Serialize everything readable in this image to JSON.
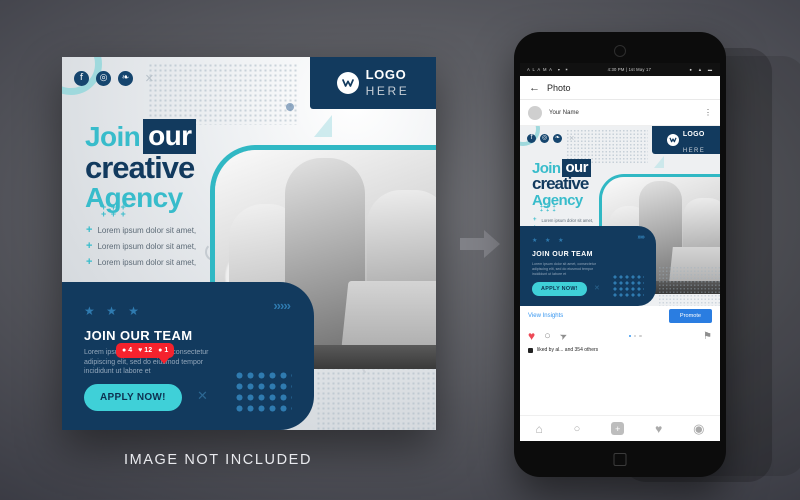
{
  "caption": "IMAGE NOT INCLUDED",
  "colors": {
    "navy": "#123a5e",
    "teal": "#38bccb",
    "teal_bright": "#3fd0d8",
    "instagram_blue": "#3897f0",
    "promote_blue": "#2a7de1",
    "badge_red": "#f5222d"
  },
  "poster": {
    "social": [
      {
        "name": "facebook-icon",
        "glyph": "f"
      },
      {
        "name": "instagram-icon",
        "glyph": "◎"
      },
      {
        "name": "twitter-icon",
        "glyph": "❧"
      }
    ],
    "close_mark": "×",
    "logo": {
      "line1": "LOGO",
      "line2": "HERE"
    },
    "headline": {
      "pre": "Join",
      "highlight": "our",
      "line2": "creative",
      "line3": "Agency"
    },
    "plus_grid": "+ + +\n+ + +",
    "bullets": [
      "Lorem ipsum dolor sit amet,",
      "Lorem ipsum dolor sit amet,",
      "Lorem ipsum dolor sit amet,"
    ],
    "bullet_marker": "+",
    "panel": {
      "chevrons": "›››››",
      "stars": "★ ★ ★",
      "title": "JOIN OUR TEAM",
      "body": "Lorem ipsum dolor sit amet, consectetur adipiscing elit, sed do eiusmod tempor incididunt ut labore et",
      "cta": "APPLY NOW!",
      "x_mark": "✕"
    }
  },
  "phone": {
    "statusbar": {
      "carrier": "A L A M A",
      "wifi_icon": "▾",
      "bluetooth_icon": "✶",
      "time": "4:30 PM | 1st May 17",
      "alarm_icon": "●",
      "signal_icon": "▲",
      "battery_icon": "▬"
    },
    "appbar": {
      "back_icon": "←",
      "title": "Photo"
    },
    "user": {
      "name": "Your Name",
      "menu_icon": "⋮"
    },
    "actions": {
      "like_icon": "♥",
      "comment_icon": "○",
      "share_icon": "➤",
      "save_icon": "⚑"
    },
    "insights": {
      "link": "View Insights",
      "promote": "Promote"
    },
    "liked_by": "liked by  al...  and 354 others",
    "badge": {
      "comments": "4",
      "likes": "12",
      "follows": "1",
      "comment_icon": "●",
      "heart_icon": "♥",
      "person_icon": "●"
    },
    "tabs": [
      {
        "name": "tab-home",
        "icon": "⌂"
      },
      {
        "name": "tab-search",
        "icon": "○"
      },
      {
        "name": "tab-add",
        "icon": "+"
      },
      {
        "name": "tab-activity",
        "icon": "♥"
      },
      {
        "name": "tab-profile",
        "icon": "◉"
      }
    ]
  }
}
